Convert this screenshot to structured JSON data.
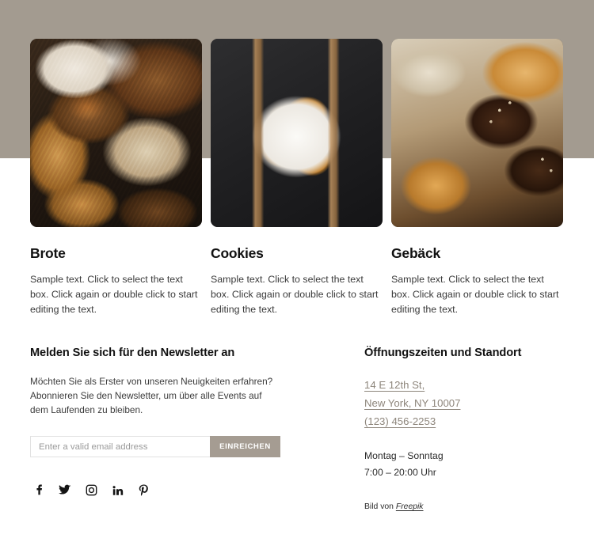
{
  "theme": {
    "band_color": "#a39b90",
    "button_color": "#a59c92",
    "link_color": "#8e867c",
    "page_background": "#ffffff",
    "heading_color": "#111111",
    "body_text_color": "#3a3a3a"
  },
  "gallery": {
    "cards": [
      {
        "image_name": "assorted-breads-photo",
        "title": "Brote",
        "text": "Sample text. Click to select the text box. Click again or double click to start editing the text."
      },
      {
        "image_name": "cookies-pastries-photo",
        "title": "Cookies",
        "text": "Sample text. Click to select the text box. Click again or double click to start editing the text."
      },
      {
        "image_name": "chocolate-pastries-photo",
        "title": "Gebäck",
        "text": "Sample text. Click to select the text box. Click again or double click to start editing the text."
      }
    ]
  },
  "newsletter": {
    "title": "Melden Sie sich für den Newsletter an",
    "description": "Möchten Sie als Erster von unseren Neuigkeiten erfahren? Abonnieren Sie den Newsletter, um über alle Events auf dem Laufenden zu bleiben.",
    "email_placeholder": "Enter a valid email address",
    "email_value": "",
    "submit_label": "EINREICHEN"
  },
  "socials": [
    {
      "name": "facebook-icon",
      "label": "Facebook"
    },
    {
      "name": "twitter-icon",
      "label": "Twitter"
    },
    {
      "name": "instagram-icon",
      "label": "Instagram"
    },
    {
      "name": "linkedin-icon",
      "label": "LinkedIn"
    },
    {
      "name": "pinterest-icon",
      "label": "Pinterest"
    }
  ],
  "contact": {
    "title": "Öffnungszeiten und Standort",
    "address_line_1": "14 E 12th St,",
    "address_line_2": "New York, NY 10007",
    "phone": "(123) 456-2253",
    "hours_days": "Montag – Sonntag",
    "hours_time": "7:00 – 20:00 Uhr",
    "credit_prefix": "Bild von ",
    "credit_link": "Freepik"
  }
}
